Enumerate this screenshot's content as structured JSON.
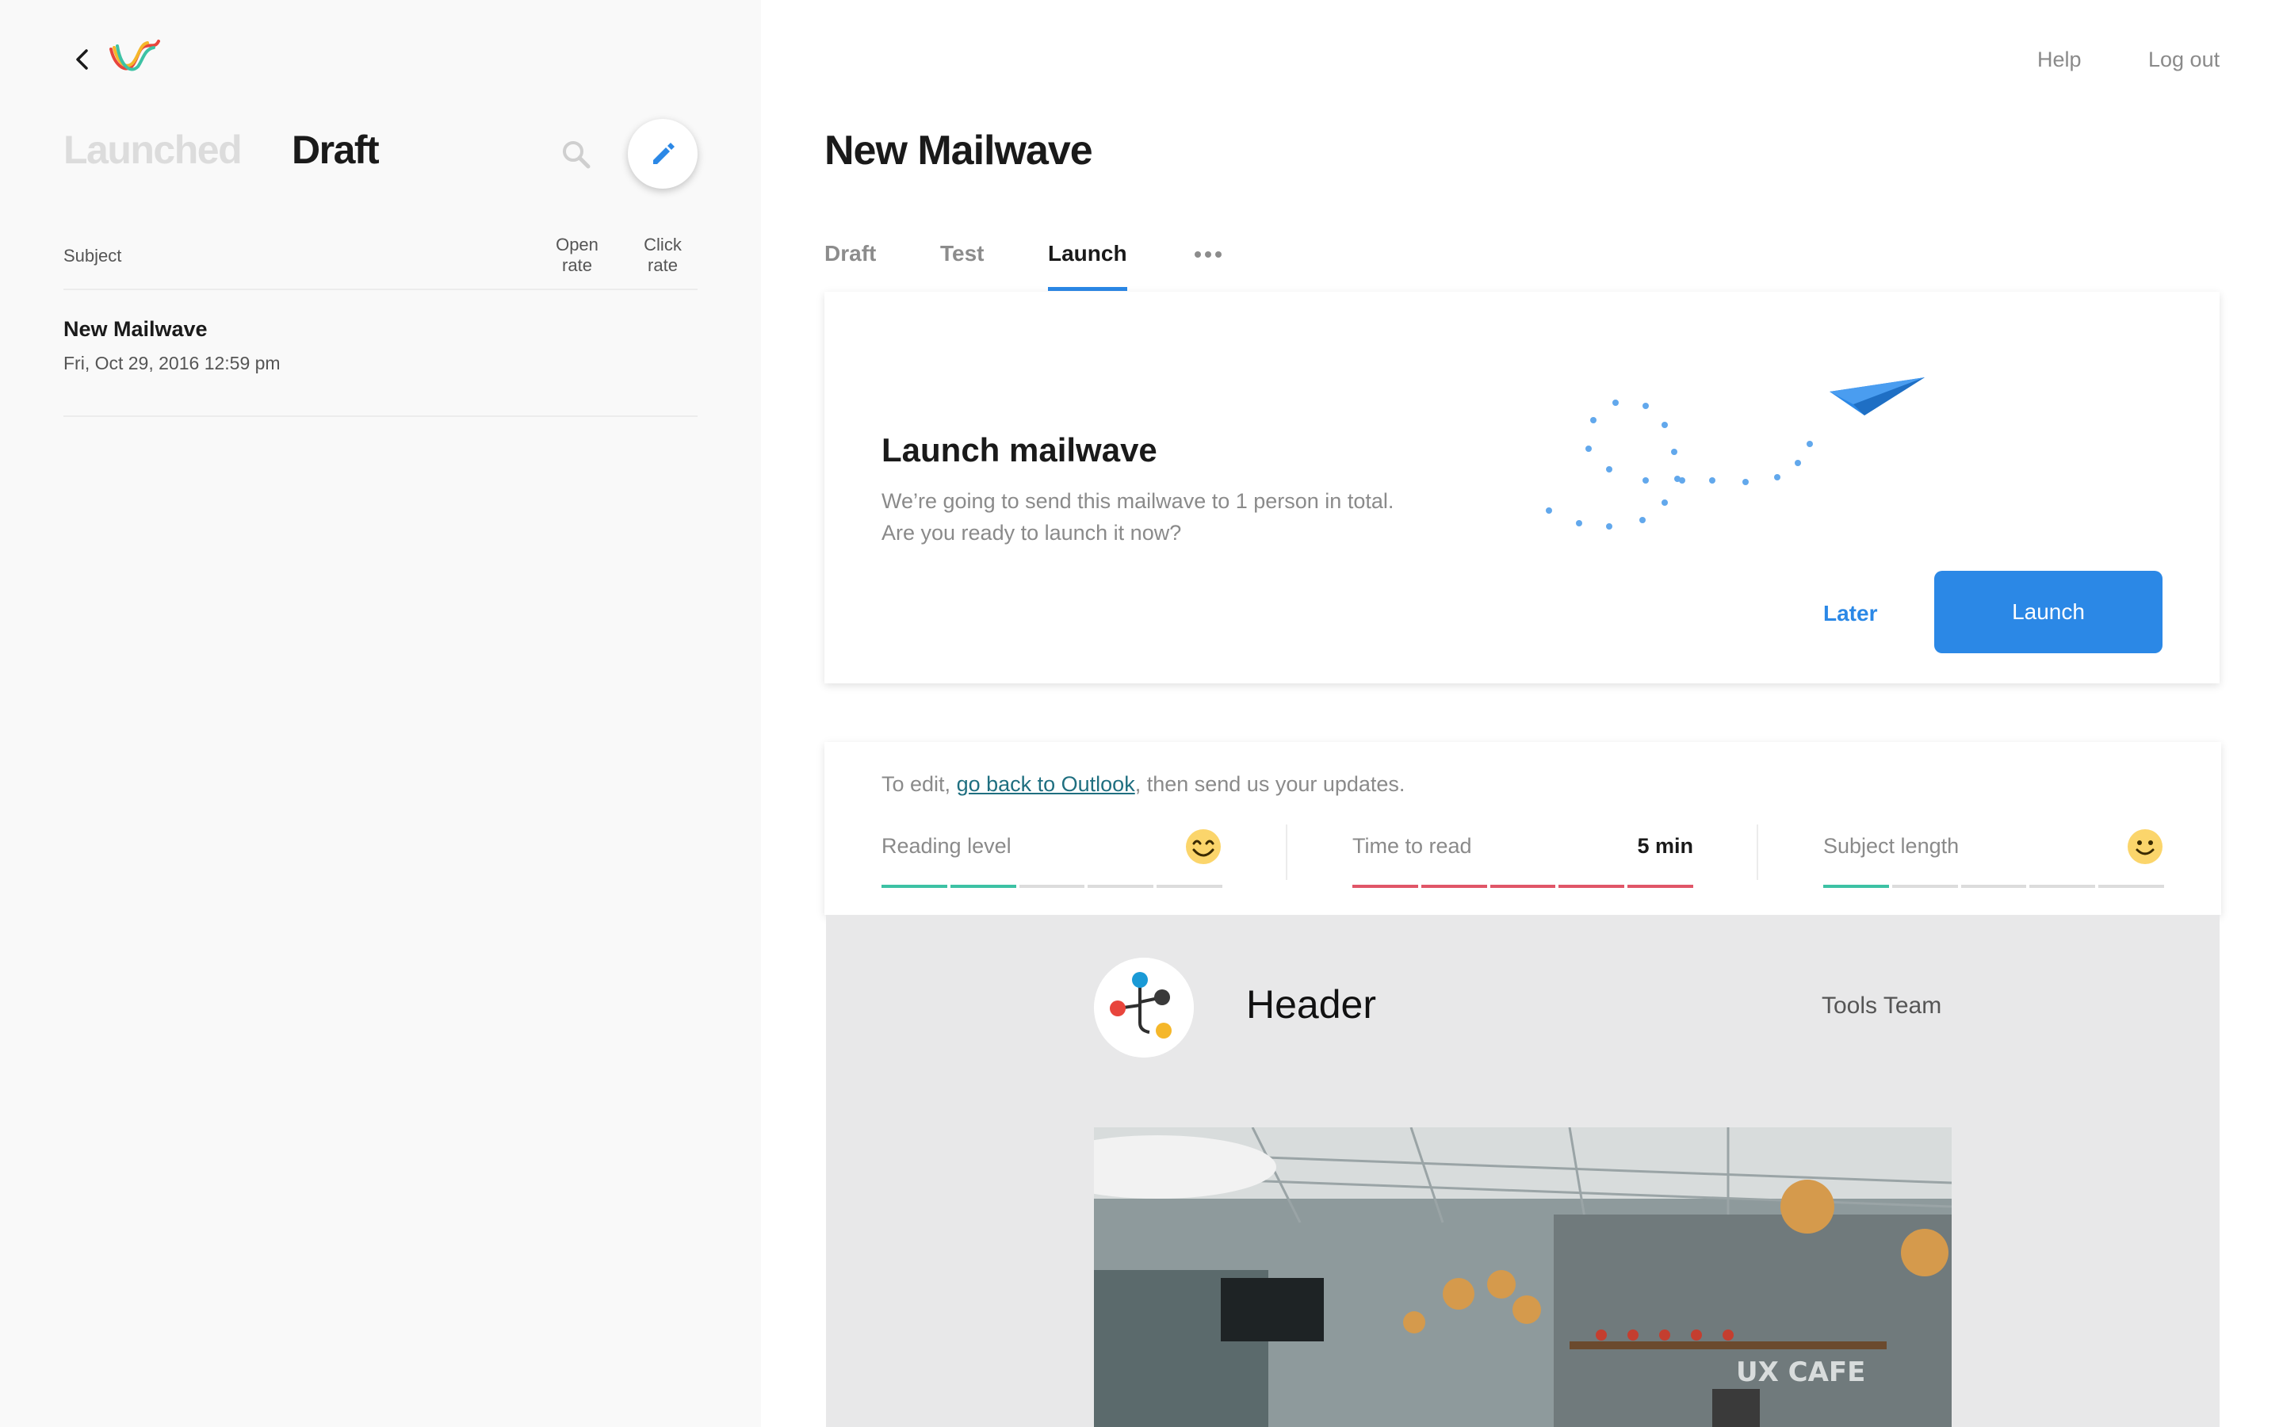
{
  "app": {
    "back_icon": "chevron-left-icon",
    "logo_icon": "mailwave-logo",
    "nav": {
      "help": "Help",
      "logout": "Log out"
    }
  },
  "sidebar": {
    "tabs": {
      "launched": "Launched",
      "draft": "Draft"
    },
    "search_icon": "search-icon",
    "compose_icon": "pencil-icon",
    "columns": {
      "subject": "Subject",
      "open_rate": [
        "Open",
        "rate"
      ],
      "click_rate": [
        "Click",
        "rate"
      ]
    },
    "items": [
      {
        "title": "New Mailwave",
        "date": "Fri, Oct 29, 2016  12:59 pm"
      }
    ]
  },
  "main": {
    "title": "New Mailwave",
    "tabs": [
      "Draft",
      "Test",
      "Launch"
    ],
    "active_tab": "Launch",
    "more_icon": "more-horizontal-icon",
    "launch_card": {
      "heading": "Launch mailwave",
      "lines": [
        "We’re going to send this mailwave to 1 person in total.",
        "Are you ready to launch it now?"
      ],
      "illustration": "paper-plane-icon",
      "later": "Later",
      "launch": "Launch"
    },
    "metrics_card": {
      "note_prefix": "To edit, ",
      "note_link": "go back to Outlook",
      "note_suffix": ", then send us your updates.",
      "metrics": [
        {
          "label": "Reading level",
          "value": "",
          "icon": "smiley-icon",
          "score": 2,
          "of": 5,
          "status_color": "#3dc2a4"
        },
        {
          "label": "Time to read",
          "value": "5 min",
          "icon": "",
          "score": 5,
          "of": 5,
          "status_color": "#e05668"
        },
        {
          "label": "Subject length",
          "value": "",
          "icon": "smiley-icon",
          "score": 1,
          "of": 5,
          "status_color": "#3dc2a4"
        }
      ]
    },
    "preview": {
      "header": "Header",
      "team": "Tools Team",
      "logo_icon": "team-logo-icon",
      "photo_sign": "UX CAFE"
    }
  },
  "colors": {
    "accent": "#2b88e6",
    "good": "#3dc2a4",
    "bad": "#e05668",
    "link": "#1f6f80"
  }
}
